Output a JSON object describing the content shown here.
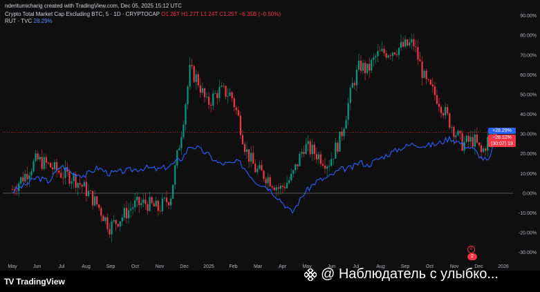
{
  "header": {
    "credit": "nderitumicharig created with TradingView.com, Dec 05, 2025 15:12 UTC",
    "series1_name": "Crypto Total Market Cap Excluding BTC, 5 · 1D · CRYPTOCAP",
    "o_label": "O",
    "o_value": "1.26T",
    "h_label": "H",
    "h_value": "1.27T",
    "l_label": "L",
    "l_value": "1.24T",
    "c_label": "C",
    "c_value": "1.25T",
    "change": "−6.35B (−0.50%)",
    "series2_name": "RUT · TVC",
    "series2_value": "28.29%"
  },
  "badges": {
    "blue": "+28.29%",
    "red_top": "−28.12%",
    "red_bottom": "(30:07) 19"
  },
  "flag_text": "2",
  "event_icon": "σ",
  "footer": {
    "brand": "TradingView",
    "logo_mark": "TV",
    "watermark": "@ Наблюдатель с улыбко..."
  },
  "colors": {
    "background": "#0f0f0f",
    "up_candle": "#089981",
    "down_candle": "#f23645",
    "comparison_line": "#2962ff",
    "axis_text": "#b2b5be"
  },
  "chart_data": {
    "type": "line",
    "xlabels": [
      "May",
      "Jun",
      "Jul",
      "Aug",
      "Sep",
      "Oct",
      "Nov",
      "Dec",
      "2025",
      "Feb",
      "Mar",
      "Apr",
      "May",
      "Jun",
      "Jul",
      "Aug",
      "Sep",
      "Oct",
      "Nov",
      "Dec",
      "2026"
    ],
    "yticks": [
      "90.00%",
      "80.00%",
      "70.00%",
      "60.00%",
      "50.00%",
      "40.00%",
      "30.00%",
      "20.00%",
      "10.00%",
      "0.00%",
      "-10.00%",
      "-20.00%",
      "-30.00%"
    ],
    "ytick_values": [
      90,
      80,
      70,
      60,
      50,
      40,
      30,
      20,
      10,
      0,
      -10,
      -20,
      -30
    ],
    "ylim": [
      -35,
      93
    ],
    "xlim": [
      0,
      20.2
    ],
    "series": [
      {
        "name": "Crypto Total Market Cap Excluding BTC",
        "style": "candles",
        "x": [
          0,
          0.5,
          1,
          1.5,
          2,
          2.5,
          3,
          3.5,
          4,
          4.5,
          5,
          5.5,
          6,
          6.5,
          7,
          7.3,
          7.6,
          8,
          8.5,
          9,
          9.3,
          9.6,
          10,
          10.5,
          11,
          11.5,
          12,
          12.5,
          13,
          13.5,
          14,
          14.3,
          14.6,
          15,
          15.5,
          16,
          16.5,
          17,
          17.5,
          18,
          18.5,
          19,
          19.3,
          19.6,
          19.9
        ],
        "values": [
          2,
          9,
          17,
          14,
          10,
          8,
          2,
          -6,
          -17,
          -12,
          -6,
          -5,
          -8,
          -2,
          35,
          62,
          58,
          45,
          52,
          50,
          38,
          22,
          12,
          8,
          2,
          8,
          24,
          20,
          15,
          28,
          55,
          65,
          62,
          70,
          72,
          74,
          76,
          56,
          48,
          36,
          25,
          27,
          20,
          28,
          31
        ]
      },
      {
        "name": "RUT",
        "style": "line",
        "x": [
          0,
          0.5,
          1,
          1.5,
          2,
          2.5,
          3,
          3.5,
          4,
          4.5,
          5,
          5.5,
          6,
          6.5,
          7,
          7.3,
          7.6,
          8,
          8.5,
          9,
          9.3,
          9.6,
          10,
          10.5,
          11,
          11.5,
          12,
          12.5,
          13,
          13.5,
          14,
          14.3,
          14.6,
          15,
          15.5,
          16,
          16.5,
          17,
          17.5,
          18,
          18.5,
          19,
          19.3,
          19.6,
          19.9
        ],
        "values": [
          1,
          4,
          8,
          6,
          14,
          10,
          9,
          13,
          10,
          11,
          12,
          13,
          12,
          14,
          18,
          24,
          23,
          20,
          15,
          15,
          16,
          12,
          6,
          3,
          -3,
          -10,
          0,
          6,
          8,
          12,
          13,
          16,
          14,
          17,
          20,
          23,
          25,
          24,
          25,
          28,
          25,
          22,
          18,
          16,
          28.3
        ]
      }
    ]
  }
}
